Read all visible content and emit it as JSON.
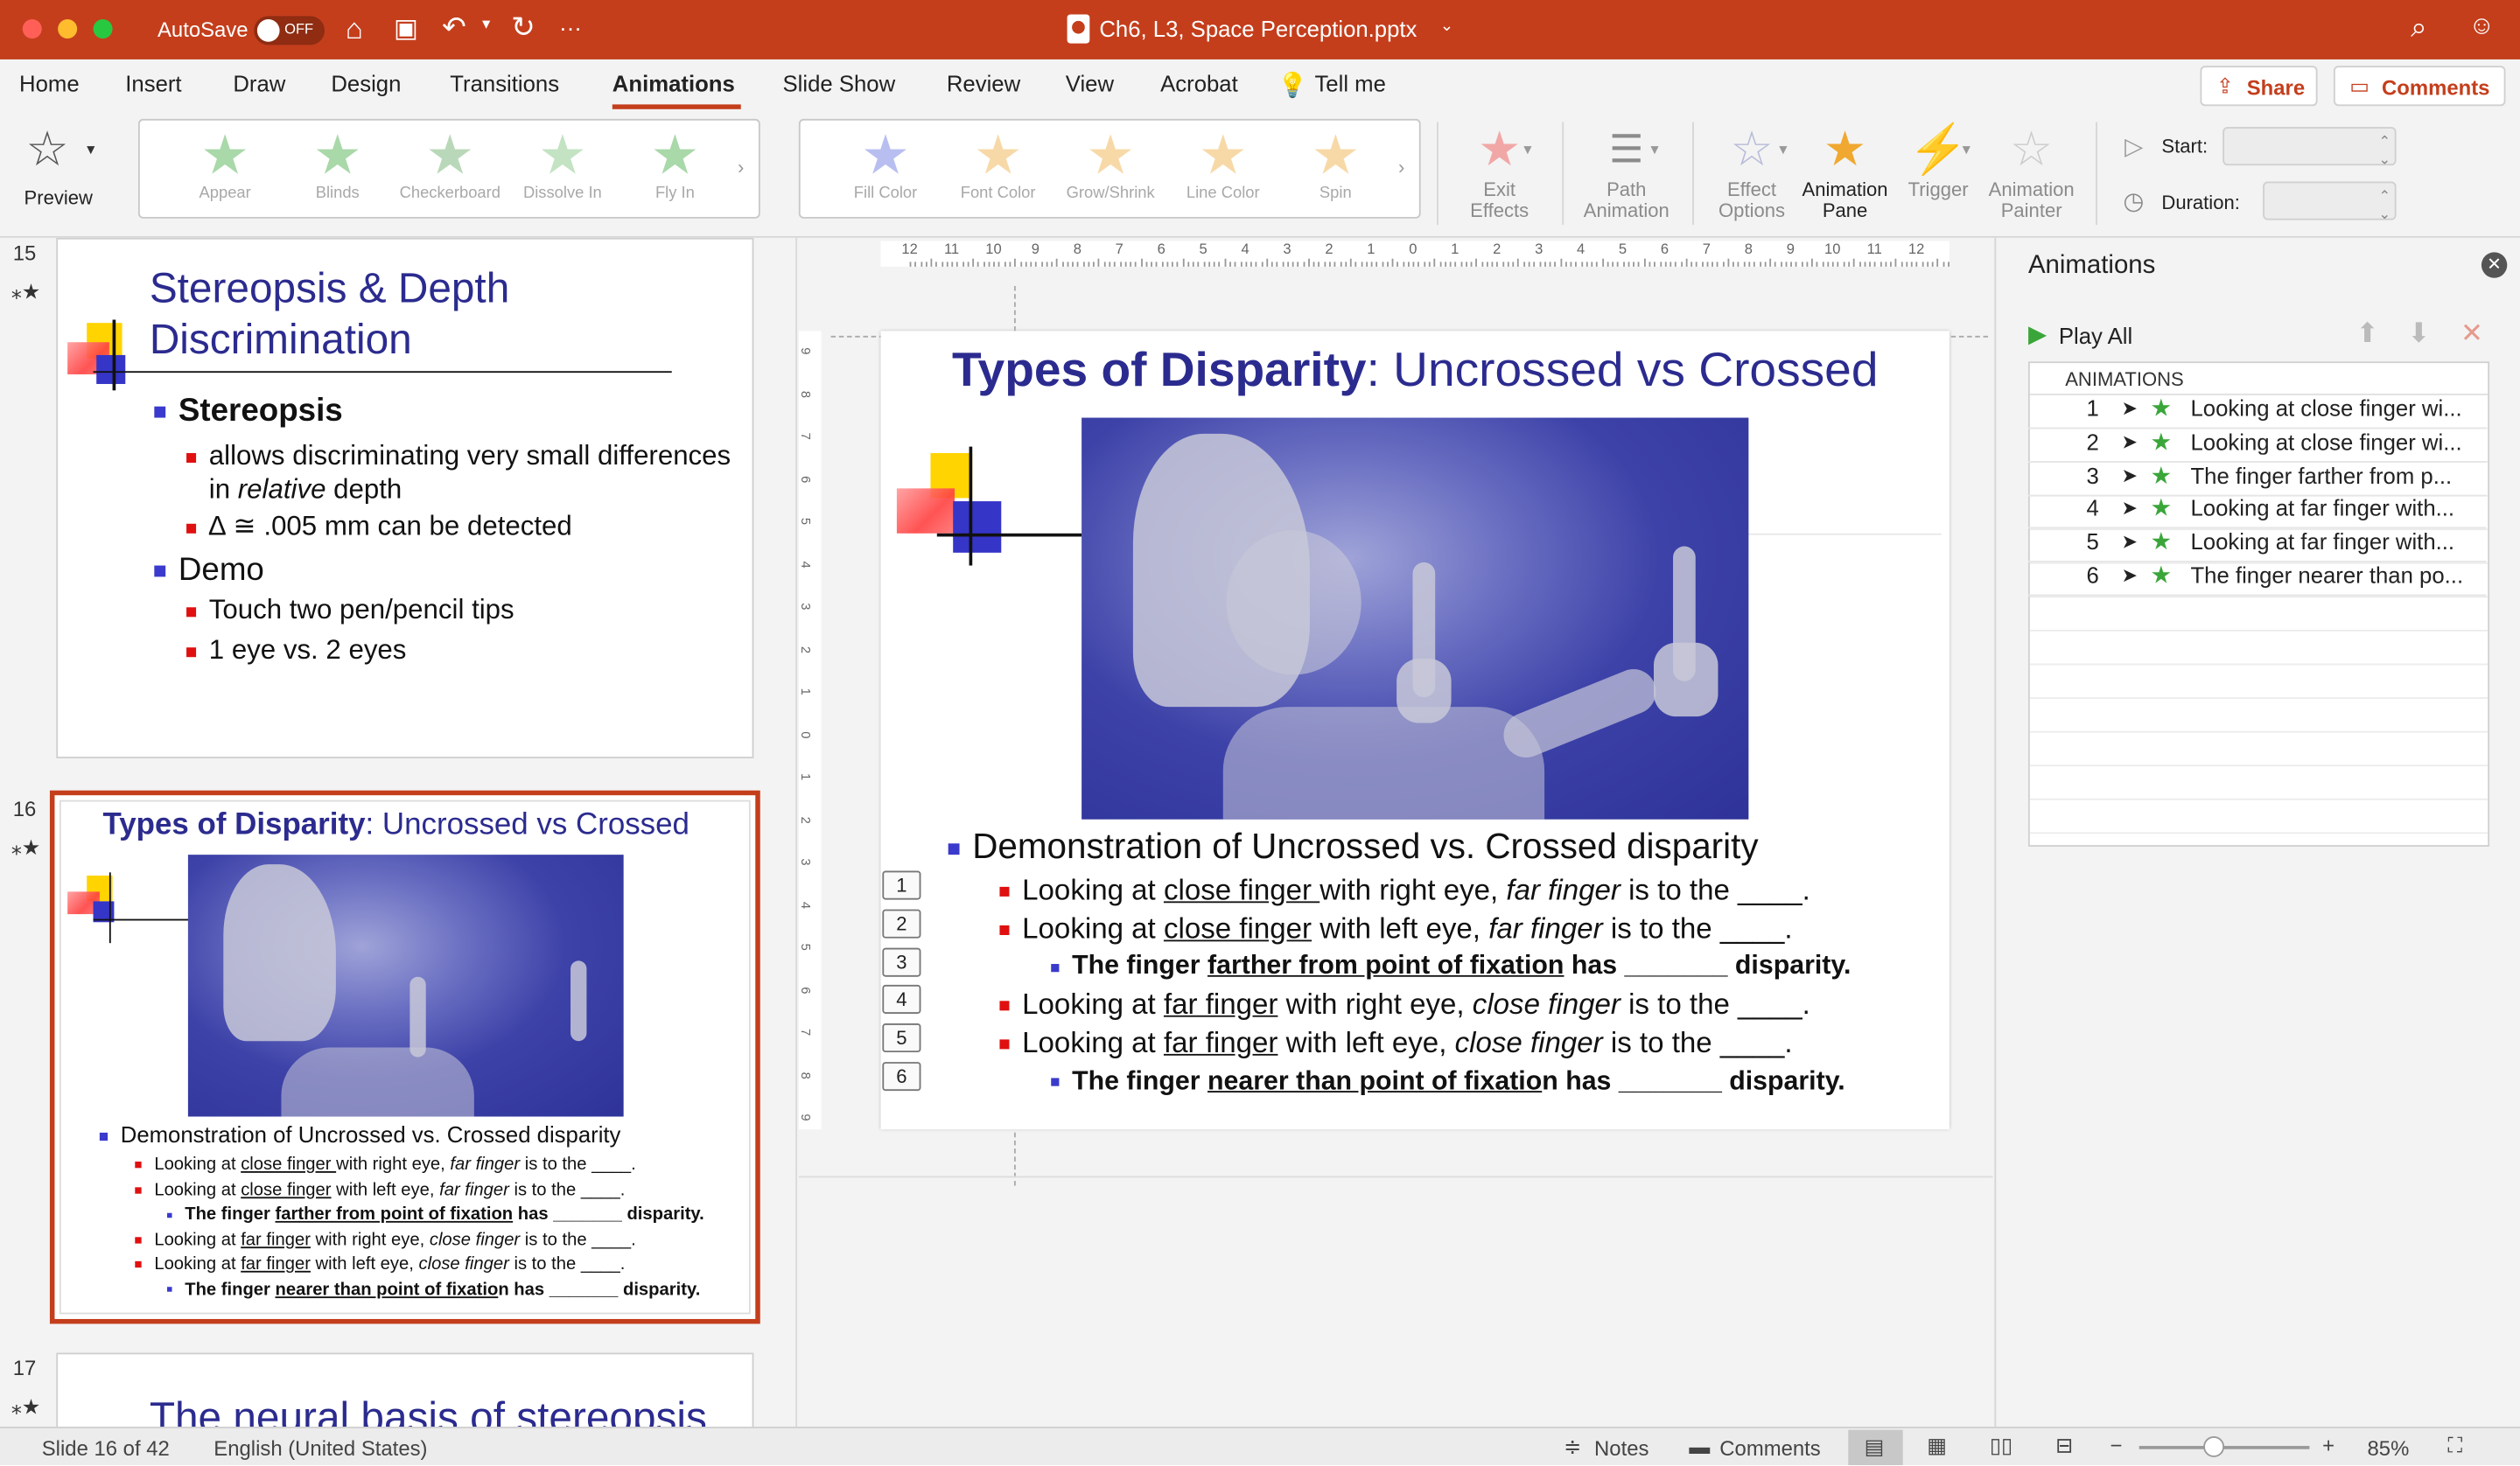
{
  "window": {
    "title": "Ch6, L3, Space Perception.pptx",
    "autosave_label": "AutoSave",
    "autosave_state": "OFF",
    "more": "···"
  },
  "menu_tabs": [
    "Home",
    "Insert",
    "Draw",
    "Design",
    "Transitions",
    "Animations",
    "Slide Show",
    "Review",
    "View",
    "Acrobat"
  ],
  "tell_me": "Tell me",
  "share_label": "Share",
  "comments_label": "Comments",
  "ribbon": {
    "preview_label": "Preview",
    "effects": [
      "Appear",
      "Blinds",
      "Checkerboard",
      "Dissolve In",
      "Fly In"
    ],
    "emphasis": [
      "Fill Color",
      "Font Color",
      "Grow/Shrink",
      "Line Color",
      "Spin"
    ],
    "exit_effects": [
      "Exit",
      "Effects"
    ],
    "path_animation": [
      "Path",
      "Animation"
    ],
    "effect_options": [
      "Effect",
      "Options"
    ],
    "animation_pane": [
      "Animation",
      "Pane"
    ],
    "trigger": "Trigger",
    "animation_painter": [
      "Animation",
      "Painter"
    ],
    "start_label": "Start:",
    "duration_label": "Duration:"
  },
  "thumbnails": [
    {
      "num": "15",
      "title_line1": "Stereopsis & Depth",
      "title_line2": "Discrimination",
      "b1": "Stereopsis",
      "b1a_line1": "allows discriminating very small differences",
      "b1a_pre": "in ",
      "b1a_em": "relative",
      "b1a_post": " depth",
      "b1b": "∆ ≅ .005 mm can be detected",
      "b2": "Demo",
      "b2a": "Touch two pen/pencil tips",
      "b2b": "1 eye vs. 2 eyes"
    },
    {
      "num": "16"
    },
    {
      "num": "17",
      "title": "The neural basis of stereopsis"
    }
  ],
  "slide": {
    "title_bold": "Types of Disparity",
    "title_rest": ": Uncrossed vs Crossed",
    "bullet_main": "Demonstration of Uncrossed vs. Crossed disparity",
    "l1": {
      "pre": "Looking at ",
      "u": "close finger ",
      "mid": "with right eye, ",
      "em": "far finger",
      "post": " is to the ____."
    },
    "l2": {
      "pre": "Looking at ",
      "u": "close finger",
      "mid": " with left eye, ",
      "em": "far finger",
      "post": " is to the ____."
    },
    "l3": {
      "pre": "The finger ",
      "u": "farther from point of fixation",
      "post": " has _______ disparity."
    },
    "l4": {
      "pre": "Looking at ",
      "u": "far finger",
      "mid": " with right eye, ",
      "em": "close finger",
      "post": " is to the ____."
    },
    "l5": {
      "pre": "Looking at ",
      "u": "far finger",
      "mid": " with left eye, ",
      "em": "close finger",
      "post": " is to the ____."
    },
    "l6": {
      "pre": "The finger ",
      "u": "nearer than point of fixatio",
      "post": "n has _______ disparity."
    },
    "tags": [
      "1",
      "2",
      "3",
      "4",
      "5",
      "6"
    ]
  },
  "ruler_top": [
    "12",
    "11",
    "10",
    "9",
    "8",
    "7",
    "6",
    "5",
    "4",
    "3",
    "2",
    "1",
    "0",
    "1",
    "2",
    "3",
    "4",
    "5",
    "6",
    "7",
    "8",
    "9",
    "10",
    "11",
    "12"
  ],
  "ruler_left": [
    "9",
    "8",
    "7",
    "6",
    "5",
    "4",
    "3",
    "2",
    "1",
    "0",
    "1",
    "2",
    "3",
    "4",
    "5",
    "6",
    "7",
    "8",
    "9"
  ],
  "animation_pane": {
    "title": "Animations",
    "play_all": "Play All",
    "list_header": "ANIMATIONS",
    "items": [
      {
        "n": "1",
        "text": "Looking at close finger wi..."
      },
      {
        "n": "2",
        "text": "Looking at close finger wi..."
      },
      {
        "n": "3",
        "text": "The finger farther from p..."
      },
      {
        "n": "4",
        "text": "Looking at far finger with..."
      },
      {
        "n": "5",
        "text": "Looking at far finger with..."
      },
      {
        "n": "6",
        "text": "The finger nearer than po..."
      }
    ]
  },
  "status": {
    "slide_info": "Slide 16 of 42",
    "language": "English (United States)",
    "notes": "Notes",
    "comments": "Comments",
    "zoom": "85%"
  },
  "colors": {
    "titlebar": "#c43e1c",
    "accent": "#c43e1c",
    "slide_title": "#2b2b8f"
  }
}
